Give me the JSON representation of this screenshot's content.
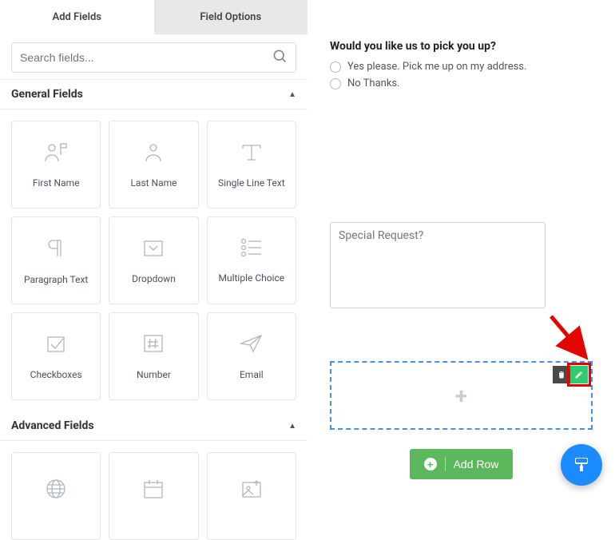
{
  "tabs": {
    "add_fields": "Add Fields",
    "field_options": "Field Options"
  },
  "search": {
    "placeholder": "Search fields..."
  },
  "sections": {
    "general": {
      "title": "General Fields"
    },
    "advanced": {
      "title": "Advanced Fields"
    }
  },
  "general_fields": [
    {
      "label": "First Name"
    },
    {
      "label": "Last Name"
    },
    {
      "label": "Single Line Text"
    },
    {
      "label": "Paragraph Text"
    },
    {
      "label": "Dropdown"
    },
    {
      "label": "Multiple Choice"
    },
    {
      "label": "Checkboxes"
    },
    {
      "label": "Number"
    },
    {
      "label": "Email"
    }
  ],
  "question": {
    "title": "Would you like us to pick you up?",
    "options": [
      "Yes please. Pick me up on my address.",
      "No Thanks."
    ]
  },
  "special_request": {
    "placeholder": "Special Request?"
  },
  "add_row_label": "Add Row"
}
